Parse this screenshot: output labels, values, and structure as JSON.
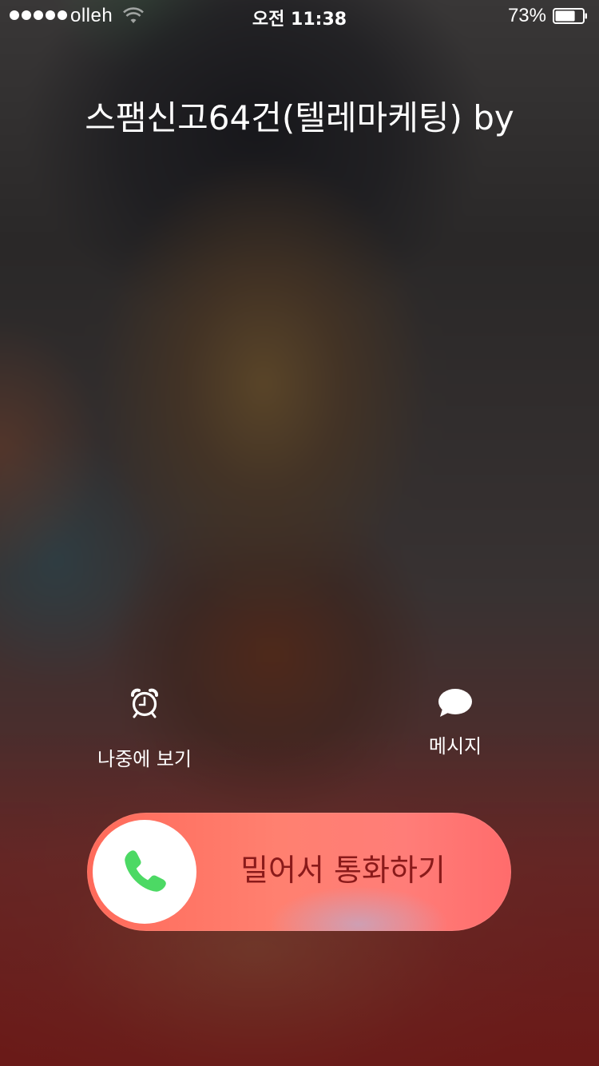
{
  "status_bar": {
    "signal_bars": 5,
    "carrier": "olleh",
    "time": "오전 11:38",
    "battery_percent": "73%",
    "battery_level": 0.73,
    "wifi_icon": "wifi-icon"
  },
  "incoming_call": {
    "caller_label": "스팸신고64건(텔레마케팅) by"
  },
  "actions": {
    "remind_label": "나중에 보기",
    "remind_icon": "alarm-clock-icon",
    "message_label": "메시지",
    "message_icon": "speech-bubble-icon"
  },
  "slider": {
    "label": "밀어서 통화하기",
    "knob_icon": "phone-icon",
    "knob_icon_color": "#4cd964"
  }
}
